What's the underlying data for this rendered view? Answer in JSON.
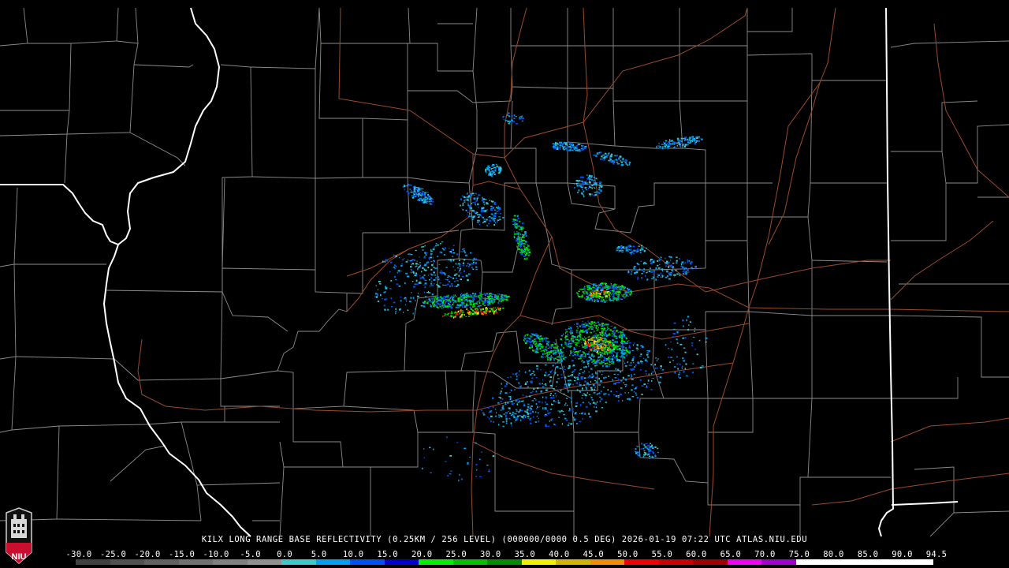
{
  "product": {
    "caption": "KILX LONG RANGE BASE REFLECTIVITY (0.25KM / 256 LEVEL) (000000/0000 0.5 DEG) 2026-01-19 07:22 UTC  ATLAS.NIU.EDU",
    "radar_site": "KILX",
    "timestamp": "2026-01-19 07:22 UTC",
    "elevation": "0.5 DEG",
    "source": "ATLAS.NIU.EDU"
  },
  "logo": {
    "text": "NIU",
    "icon": "niu-logo-icon",
    "color": "#c8102e"
  },
  "scale": {
    "labels": [
      "-30.0",
      "-25.0",
      "-20.0",
      "-15.0",
      "-10.0",
      "-5.0",
      "0.0",
      "5.0",
      "10.0",
      "15.0",
      "20.0",
      "25.0",
      "30.0",
      "35.0",
      "40.0",
      "45.0",
      "50.0",
      "55.0",
      "60.0",
      "65.0",
      "70.0",
      "75.0",
      "80.0",
      "85.0",
      "90.0",
      "94.5"
    ],
    "colors": [
      "#404040",
      "#505050",
      "#606060",
      "#707070",
      "#808080",
      "#909090",
      "#3cc8c8",
      "#00a0f0",
      "#0050f0",
      "#0000c8",
      "#00f000",
      "#00c000",
      "#008c00",
      "#f0f000",
      "#d2b400",
      "#f08c00",
      "#f00000",
      "#c80000",
      "#a00000",
      "#f000f0",
      "#a000c8",
      "#ffffff",
      "#ffffff",
      "#ffffff",
      "#ffffff"
    ]
  },
  "map_colors": {
    "state_border": "#ffffff",
    "county_border": "#a0a0a0",
    "highway": "#a0522d",
    "background": "#000000"
  }
}
